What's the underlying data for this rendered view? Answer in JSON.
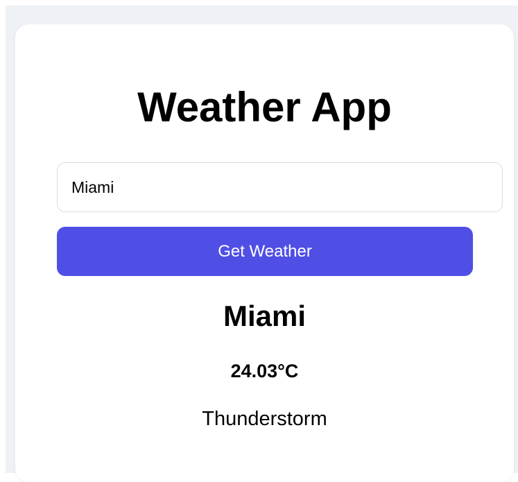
{
  "app": {
    "title": "Weather App"
  },
  "search": {
    "value": "Miami",
    "button_label": "Get Weather"
  },
  "result": {
    "city": "Miami",
    "temperature": "24.03°C",
    "description": "Thunderstorm"
  },
  "colors": {
    "accent": "#4f4fe6",
    "background": "#eef1f5",
    "card": "#ffffff"
  }
}
